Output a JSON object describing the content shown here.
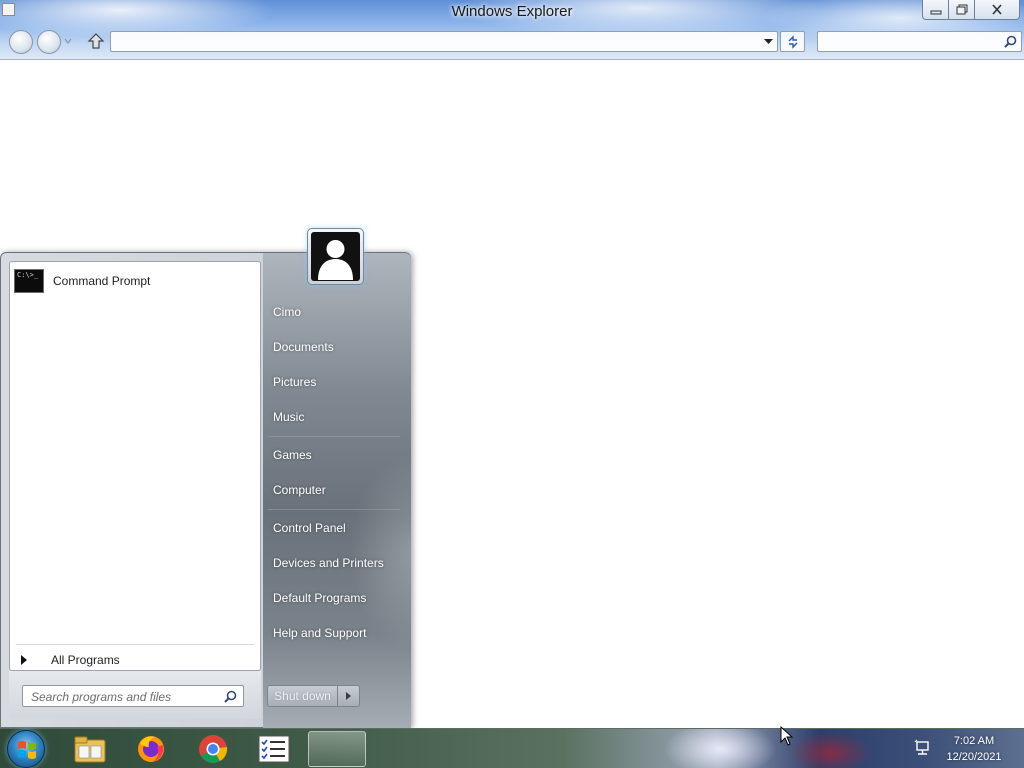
{
  "window": {
    "title": "Windows Explorer",
    "address_value": "",
    "search_value": ""
  },
  "start_menu": {
    "pinned": [
      {
        "label": "Command Prompt",
        "icon": "command-prompt-icon",
        "icon_text": "C:\\>_"
      }
    ],
    "all_programs_label": "All Programs",
    "search_placeholder": "Search programs and files",
    "right_links": [
      "Cimo",
      "Documents",
      "Pictures",
      "Music",
      "Games",
      "Computer",
      "Control Panel",
      "Devices and Printers",
      "Default Programs",
      "Help and Support"
    ],
    "shutdown_label": "Shut down"
  },
  "taskbar": {
    "apps": [
      {
        "name": "Windows Explorer",
        "icon": "folder-icon"
      },
      {
        "name": "Firefox",
        "icon": "firefox-icon"
      },
      {
        "name": "Chrome",
        "icon": "chrome-icon"
      },
      {
        "name": "Tasks",
        "icon": "checklist-icon"
      }
    ],
    "time": "7:02 AM",
    "date": "12/20/2021"
  },
  "colors": {
    "start_menu_right_pane": "#6f7780",
    "titlebar_accent": "#8db4ea"
  }
}
